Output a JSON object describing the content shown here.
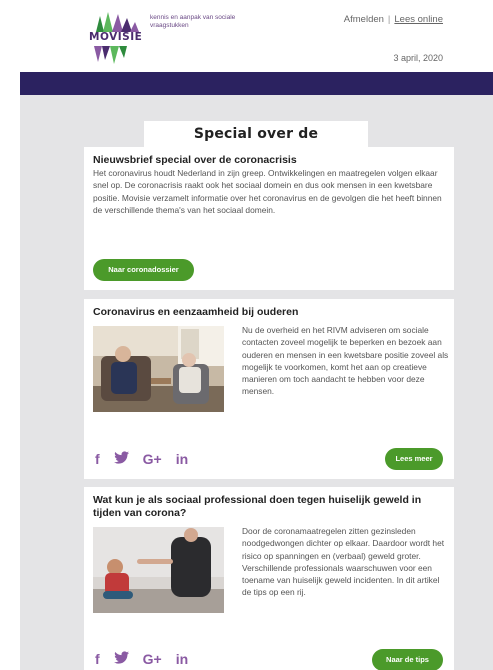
{
  "header": {
    "logo_text": "MOVISIE",
    "tagline": "kennis en aanpak van sociale vraagstukken",
    "unsubscribe": "Afmelden",
    "separator": "|",
    "read_online": "Lees online",
    "date": "3 april, 2020"
  },
  "special_title": "Special over de coronacrisis",
  "intro": {
    "heading": "Nieuwsbrief special over de coronacrisis",
    "body": "Het coronavirus houdt Nederland in zijn greep. Ontwikkelingen en maatregelen volgen elkaar snel op. De coronacrisis raakt ook het sociaal domein en dus ook mensen in een kwetsbare positie. Movisie verzamelt informatie over het coronavirus en de gevolgen die het heeft binnen de verschillende thema's van het sociaal domein.",
    "button": "Naar coronadossier"
  },
  "articles": [
    {
      "heading": "Coronavirus en eenzaamheid bij ouderen",
      "body": "Nu de overheid en het RIVM adviseren om sociale contacten zoveel mogelijk te beperken en bezoek aan ouderen en mensen in een kwetsbare positie zoveel als mogelijk te voorkomen, komt het aan op creatieve manieren om toch aandacht te hebben voor deze mensen.",
      "button": "Lees meer"
    },
    {
      "heading": "Wat kun je als sociaal professional doen tegen huiselijk geweld in tijden van corona?",
      "body": "Door de coronamaatregelen zitten gezinsleden noodgedwongen dichter op elkaar. Daardoor wordt het risico op spanningen en (verbaal) geweld groter. Verschillende professionals waarschuwen voor een toename van huiselijk geweld incidenten. In dit artikel de tips op een rij.",
      "button": "Naar de tips"
    }
  ],
  "social": {
    "facebook": "f",
    "twitter_icon": "twitter-bird-icon",
    "googleplus": "G+",
    "linkedin": "in"
  },
  "colors": {
    "band": "#2b2260",
    "button": "#4b9a2a",
    "social": "#8a5aa3",
    "background": "#e4e4e6"
  }
}
